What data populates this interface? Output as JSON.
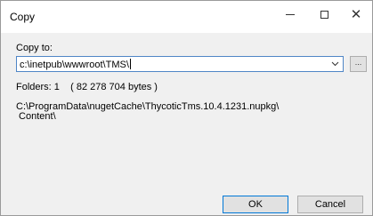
{
  "window": {
    "title": "Copy"
  },
  "form": {
    "copy_to_label": "Copy to:",
    "destination_value": "c:\\inetpub\\wwwroot\\TMS\\",
    "browse_label": "...",
    "folders_info": "Folders: 1    ( 82 278 704 bytes )",
    "source_path_line1": "C:\\ProgramData\\nugetCache\\ThycoticTms.10.4.1231.nupkg\\",
    "source_path_line2": " Content\\"
  },
  "buttons": {
    "ok_label": "OK",
    "cancel_label": "Cancel"
  },
  "icons": {
    "minimize": "minimize-icon",
    "maximize": "maximize-icon",
    "close": "close-icon",
    "dropdown": "chevron-down-icon"
  },
  "colors": {
    "accent": "#0078d7",
    "focus_border": "#4f86c6"
  }
}
